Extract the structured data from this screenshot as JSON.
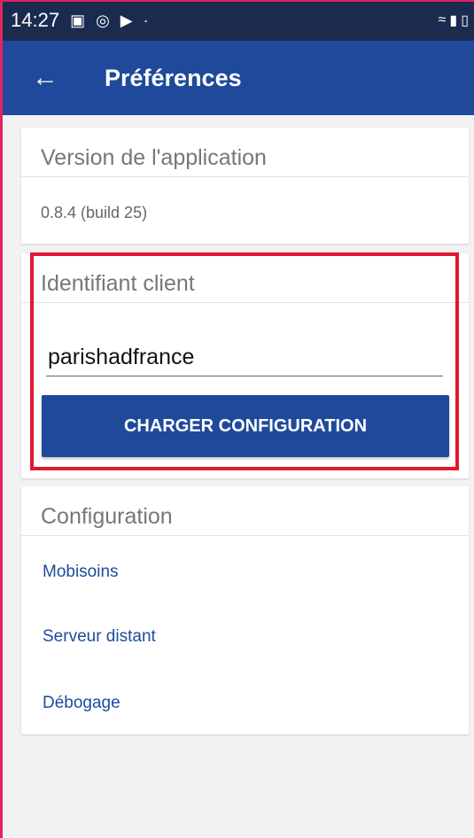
{
  "status_bar": {
    "time": "14:27",
    "icons": [
      "image-icon",
      "at-icon",
      "cast-icon",
      "dot-icon",
      "wifi-icon",
      "signal-icon",
      "battery-icon"
    ]
  },
  "app_bar": {
    "back_icon": "arrow-left-icon",
    "title": "Préférences"
  },
  "version_card": {
    "title": "Version de l'application",
    "value": "0.8.4 (build 25)"
  },
  "client_card": {
    "title": "Identifiant client",
    "input_value": "parishadfrance",
    "button_label": "CHARGER CONFIGURATION"
  },
  "config_card": {
    "title": "Configuration",
    "items": [
      "Mobisoins",
      "Serveur distant",
      "Débogage"
    ]
  },
  "colors": {
    "status_bar": "#1b2b4f",
    "app_bar": "#1f4a9b",
    "highlight_border": "#e3162f",
    "frame_accent": "#e0245e",
    "link": "#1f4a9b"
  }
}
